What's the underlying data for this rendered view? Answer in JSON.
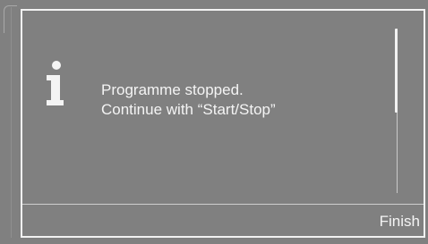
{
  "dialog": {
    "icon": "info-icon",
    "message_line1": "Programme stopped.",
    "message_line2": "Continue with “Start/Stop”",
    "finish_label": "Finish"
  },
  "colors": {
    "background": "#808080",
    "foreground": "#f4f4f4",
    "border": "#f2f2f2"
  }
}
